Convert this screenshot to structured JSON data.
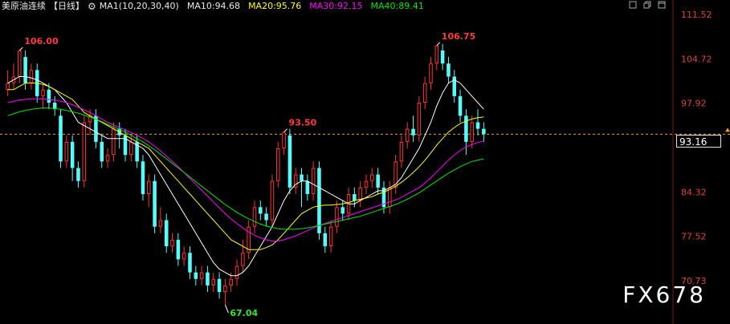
{
  "header": {
    "symbol": "美原油连续",
    "period": "【日线】",
    "settings_icon": "gear-icon",
    "ma1": "MA1(10,20,30,40)",
    "ma10": "MA10:94.68",
    "ma20": "MA20:95.76",
    "ma30": "MA30:92.15",
    "ma40": "MA40:89.41"
  },
  "toolbar_icons": [
    "square-icon",
    "restore-icon",
    "maximize-icon"
  ],
  "watermark": "FX678",
  "colors": {
    "up": "#ff3232",
    "down": "#54fcfc",
    "ma10": "#ffffff",
    "ma20": "#ffff00",
    "ma30": "#ff00ff",
    "ma40": "#00e600",
    "last_line": "#e89b2d",
    "axis_text": "#e04040"
  },
  "chart_data": {
    "type": "candlestick",
    "ylim": [
      70.73,
      111.52
    ],
    "yticks": [
      111.52,
      104.72,
      97.92,
      84.32,
      77.52,
      70.73
    ],
    "last_price": 93.16,
    "annotations": [
      {
        "label": "106.00",
        "value": 106.0
      },
      {
        "label": "93.50",
        "value": 93.5
      },
      {
        "label": "106.75",
        "value": 106.75
      },
      {
        "label": "67.04",
        "value": 67.04
      }
    ],
    "candles": [
      [
        100,
        101,
        103,
        99
      ],
      [
        101,
        102,
        104,
        100
      ],
      [
        102,
        106,
        106,
        101
      ],
      [
        105,
        101,
        106,
        100
      ],
      [
        101,
        103,
        104,
        100
      ],
      [
        103,
        99,
        104,
        98
      ],
      [
        99,
        100,
        101,
        97
      ],
      [
        100,
        98,
        101,
        97
      ],
      [
        98,
        97,
        99,
        96
      ],
      [
        96,
        89,
        97,
        88
      ],
      [
        89,
        92,
        93,
        88
      ],
      [
        92,
        88,
        93,
        86
      ],
      [
        88,
        86,
        89,
        85
      ],
      [
        86,
        95,
        96,
        85
      ],
      [
        95,
        96,
        97,
        93
      ],
      [
        96,
        92,
        97,
        91
      ],
      [
        92,
        89,
        93,
        88
      ],
      [
        89,
        90,
        91,
        88
      ],
      [
        90,
        94,
        95,
        89
      ],
      [
        94,
        93,
        95,
        91
      ],
      [
        93,
        90,
        94,
        89
      ],
      [
        90,
        92,
        93,
        89
      ],
      [
        92,
        89,
        93,
        88
      ],
      [
        89,
        84,
        90,
        83
      ],
      [
        84,
        86,
        87,
        82
      ],
      [
        86,
        79,
        87,
        78
      ],
      [
        79,
        80,
        82,
        78
      ],
      [
        80,
        76,
        81,
        75
      ],
      [
        76,
        77,
        78,
        75
      ],
      [
        77,
        74,
        78,
        73
      ],
      [
        74,
        75,
        76,
        73
      ],
      [
        75,
        72,
        76,
        71
      ],
      [
        72,
        71,
        73,
        70
      ],
      [
        71,
        72,
        73,
        70
      ],
      [
        72,
        70,
        73,
        69
      ],
      [
        70,
        71,
        72,
        69
      ],
      [
        71,
        69,
        72,
        68
      ],
      [
        69,
        70,
        71,
        67.04
      ],
      [
        70,
        71,
        72,
        69
      ],
      [
        71,
        73,
        74,
        70
      ],
      [
        73,
        75,
        77,
        72
      ],
      [
        75,
        79,
        80,
        74
      ],
      [
        79,
        82,
        83,
        78
      ],
      [
        82,
        81,
        83,
        80
      ],
      [
        81,
        80,
        82,
        79
      ],
      [
        80,
        86,
        87,
        79
      ],
      [
        86,
        91,
        92,
        85
      ],
      [
        91,
        93.5,
        93.5,
        90
      ],
      [
        93,
        85,
        94,
        84
      ],
      [
        85,
        87,
        88,
        84
      ],
      [
        87,
        86,
        88,
        82
      ],
      [
        86,
        84,
        87,
        83
      ],
      [
        84,
        88,
        89,
        83
      ],
      [
        88,
        78,
        89,
        77
      ],
      [
        78,
        76,
        79,
        75
      ],
      [
        76,
        79,
        80,
        75
      ],
      [
        79,
        82,
        83,
        78
      ],
      [
        82,
        81,
        83,
        80
      ],
      [
        81,
        84,
        85,
        80
      ],
      [
        84,
        83,
        85,
        82
      ],
      [
        83,
        85,
        86,
        82
      ],
      [
        85,
        86,
        87,
        84
      ],
      [
        86,
        87,
        88,
        85
      ],
      [
        87,
        85,
        88,
        84
      ],
      [
        85,
        82,
        86,
        81
      ],
      [
        82,
        85,
        86,
        81
      ],
      [
        85,
        89,
        90,
        84
      ],
      [
        89,
        92,
        93,
        88
      ],
      [
        92,
        94,
        95,
        91
      ],
      [
        94,
        93,
        96,
        92
      ],
      [
        93,
        98,
        99,
        92
      ],
      [
        98,
        101,
        102,
        97
      ],
      [
        101,
        104,
        105,
        100
      ],
      [
        104,
        106.75,
        106.75,
        103
      ],
      [
        106,
        104,
        107,
        103
      ],
      [
        104,
        102,
        105,
        101
      ],
      [
        102,
        99,
        103,
        98
      ],
      [
        99,
        96,
        100,
        95
      ],
      [
        96,
        92,
        97,
        90
      ],
      [
        92,
        95,
        96,
        91
      ],
      [
        95,
        94,
        97,
        93
      ],
      [
        94,
        93.16,
        95,
        92
      ]
    ],
    "ma10": [
      101,
      101.5,
      102,
      102,
      101.8,
      101.5,
      101,
      100.5,
      100,
      99,
      98,
      96.5,
      95,
      94.5,
      94,
      93.5,
      93,
      92.5,
      92.5,
      92.5,
      92.5,
      92,
      91.5,
      91,
      90,
      88.5,
      87,
      85.5,
      84,
      82.5,
      81,
      79.5,
      78,
      76.5,
      75,
      73.5,
      72.5,
      72,
      71.5,
      71.5,
      72,
      73,
      74.5,
      76,
      77.5,
      79,
      81,
      83,
      84.5,
      85.5,
      86,
      86,
      85.5,
      85,
      84.5,
      84,
      83.5,
      83,
      82.5,
      82.5,
      83,
      83.5,
      84,
      84.5,
      84.5,
      85,
      85.5,
      86.5,
      88,
      89.5,
      91,
      93,
      95,
      97.5,
      99.5,
      101,
      101.5,
      101,
      100,
      99,
      98,
      97
    ],
    "ma20": [
      100,
      100,
      100.5,
      101,
      101,
      101,
      100.8,
      100.5,
      100,
      99.5,
      99,
      98.5,
      97.5,
      96.5,
      96,
      95.5,
      95,
      94.5,
      94,
      93.5,
      93,
      92.5,
      92,
      91.5,
      91,
      90,
      89,
      88,
      87,
      86,
      85,
      84,
      83,
      82,
      81,
      80,
      79,
      78,
      77,
      76.5,
      76,
      75.5,
      75.5,
      75.5,
      75.8,
      76.2,
      77,
      78,
      79,
      80,
      81,
      81.5,
      82,
      82.2,
      82.3,
      82.3,
      82.4,
      82.5,
      82.7,
      83,
      83.2,
      83.4,
      83.6,
      84,
      84.3,
      84.7,
      85.2,
      85.8,
      86.5,
      87.3,
      88.2,
      89.2,
      90.3,
      91.5,
      92.5,
      93.5,
      94.2,
      94.8,
      95.2,
      95.5,
      95.7,
      95.8
    ],
    "ma30": [
      98,
      98.2,
      98.4,
      98.5,
      98.6,
      98.6,
      98.6,
      98.5,
      98.4,
      98.2,
      98,
      97.7,
      97.3,
      96.9,
      96.5,
      96,
      95.5,
      95,
      94.6,
      94.2,
      93.8,
      93.4,
      93,
      92.5,
      92,
      91.3,
      90.6,
      89.8,
      89,
      88.2,
      87.3,
      86.4,
      85.5,
      84.6,
      83.7,
      82.8,
      81.9,
      81,
      80.2,
      79.5,
      78.8,
      78.2,
      77.7,
      77.3,
      77,
      76.8,
      76.8,
      77,
      77.3,
      77.6,
      78,
      78.4,
      78.8,
      79.2,
      79.5,
      79.8,
      80.1,
      80.4,
      80.7,
      81,
      81.3,
      81.6,
      81.9,
      82.2,
      82.5,
      82.8,
      83.1,
      83.5,
      84,
      84.5,
      85,
      85.7,
      86.5,
      87.4,
      88.3,
      89.2,
      90,
      90.7,
      91.2,
      91.6,
      91.9,
      92.15
    ],
    "ma40": [
      96,
      96.3,
      96.6,
      96.8,
      97,
      97.1,
      97.2,
      97.2,
      97.1,
      97,
      96.8,
      96.6,
      96.4,
      96.1,
      95.8,
      95.5,
      95.1,
      94.7,
      94.3,
      93.9,
      93.5,
      93,
      92.5,
      92,
      91.4,
      90.8,
      90.1,
      89.4,
      88.7,
      88,
      87.3,
      86.6,
      85.9,
      85.2,
      84.5,
      83.8,
      83.1,
      82.4,
      81.8,
      81.2,
      80.7,
      80.2,
      79.8,
      79.4,
      79.1,
      78.9,
      78.7,
      78.6,
      78.6,
      78.6,
      78.7,
      78.8,
      79,
      79.2,
      79.4,
      79.6,
      79.8,
      80,
      80.2,
      80.4,
      80.6,
      80.9,
      81.2,
      81.5,
      81.8,
      82.1,
      82.4,
      82.8,
      83.2,
      83.7,
      84.2,
      84.8,
      85.4,
      86,
      86.6,
      87.2,
      87.7,
      88.2,
      88.6,
      89,
      89.2,
      89.41
    ]
  }
}
